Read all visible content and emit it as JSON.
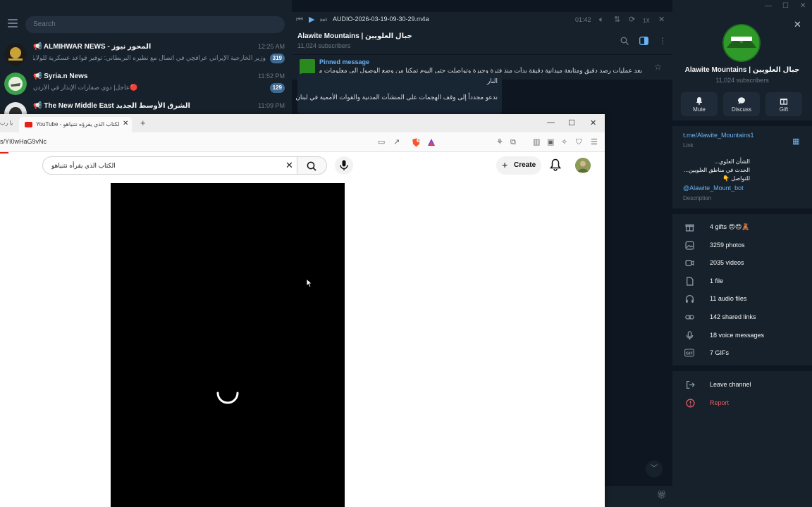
{
  "telegram": {
    "search_placeholder": "Search",
    "chats": [
      {
        "name": "📢 ALMIHWAR NEWS - المحور نيوز",
        "time": "12:25 AM",
        "message": "وزير الخارجية الإيراني عراقچي في اتصال مع نظيره البريطاني: توفير قواعد عسكرية للولايات المتحدة ...",
        "badge": "319"
      },
      {
        "name": "📢 Syria.n News",
        "time": "11:52 PM",
        "message": "🔴عاجل| دوي صفارات الإنذار في الأردن",
        "badge": "129"
      },
      {
        "name": "📢 The New Middle East الشرق الأوسط الجديد",
        "time": "11:09 PM",
        "message": "",
        "badge": ""
      }
    ],
    "audio": {
      "title": "AUDIO-2026-03-19-09-30-29.m4a",
      "time": "01:42",
      "speed": "1X"
    },
    "channel": {
      "title": "Alawite Mountains | جبال العلويين",
      "subscribers": "11,024 subscribers"
    },
    "pinned": {
      "label": "Pinned message",
      "text": "بعد عمليات رصد دقيق ومتابعة ميدانية دقيقة بدأت منذ فترة وجيزة وتواصلت حتى اليوم تمكنا من وضع الوصول الى معلومات مؤكدة ..."
    },
    "message_lines": [
      "النار",
      "ندعو مجدداً إلى وقف الهجمات على المنشآت المدنية والقوات الأممية في لبنان"
    ],
    "info": {
      "title": "Alawite Mountains | جبال العلويين",
      "subscribers": "11,024 subscribers",
      "actions": [
        {
          "label": "Mute",
          "icon": "bell-icon"
        },
        {
          "label": "Discuss",
          "icon": "chat-bubble-icon"
        },
        {
          "label": "Gift",
          "icon": "gift-icon"
        }
      ],
      "link": "t.me/Alawite_Mountains1",
      "link_label": "Link",
      "description_lines": [
        "الشأن العلوي...",
        "الحدث في مناطق العلويين...",
        "للتواصل 👇"
      ],
      "bot": "@Alawite_Mount_bot",
      "description_label": "Description",
      "media": [
        {
          "icon": "gift-icon",
          "label": "4 gifts 😍😍🧸"
        },
        {
          "icon": "photo-icon",
          "label": "3259 photos"
        },
        {
          "icon": "video-icon",
          "label": "2035 videos"
        },
        {
          "icon": "file-icon",
          "label": "1 file"
        },
        {
          "icon": "headphones-icon",
          "label": "11 audio files"
        },
        {
          "icon": "link-icon",
          "label": "142 shared links"
        },
        {
          "icon": "mic-icon",
          "label": "18 voice messages"
        },
        {
          "icon": "gif-icon",
          "label": "7 GIFs"
        }
      ],
      "leave": "Leave channel",
      "report": "Report"
    }
  },
  "browser": {
    "tab_title": "YouTube - الكتاب الذي يقرؤه نتنياهو",
    "tab_left_text": "يا رب",
    "url": "s/YI0wHaG9vNc",
    "search_value": "الكتاب الذي يقرأه نتنياهو",
    "create_label": "Create"
  },
  "colors": {
    "telegram_bg": "#17212b",
    "telegram_link": "#6ab3f3",
    "youtube_red": "#e62117",
    "report_red": "#e05d5d"
  }
}
